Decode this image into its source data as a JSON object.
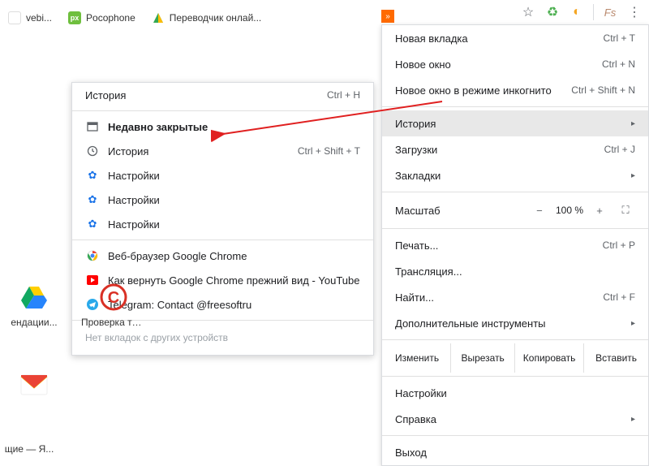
{
  "toolbar": {
    "star": "☆",
    "recycle": "♻",
    "ext2": "◐",
    "fs": "Fs",
    "more": "⋮"
  },
  "bookmarks": {
    "items": [
      {
        "label": "vebi..."
      },
      {
        "label": "Pocophone"
      },
      {
        "label": "Переводчик онлай..."
      }
    ]
  },
  "main_menu": {
    "group1": [
      {
        "label": "Новая вкладка",
        "shortcut": "Ctrl + T",
        "arrow": false,
        "highlight": false
      },
      {
        "label": "Новое окно",
        "shortcut": "Ctrl + N",
        "arrow": false,
        "highlight": false
      },
      {
        "label": "Новое окно в режиме инкогнито",
        "shortcut": "Ctrl + Shift + N",
        "arrow": false,
        "highlight": false
      }
    ],
    "group2": [
      {
        "label": "История",
        "shortcut": "",
        "arrow": true,
        "highlight": true
      },
      {
        "label": "Загрузки",
        "shortcut": "Ctrl + J",
        "arrow": false,
        "highlight": false
      },
      {
        "label": "Закладки",
        "shortcut": "",
        "arrow": true,
        "highlight": false
      }
    ],
    "zoom": {
      "label": "Масштаб",
      "minus": "−",
      "pct": "100 %",
      "plus": "+",
      "fs_icon": "⛶"
    },
    "group3": [
      {
        "label": "Печать...",
        "shortcut": "Ctrl + P",
        "arrow": false
      },
      {
        "label": "Трансляция...",
        "shortcut": "",
        "arrow": false
      },
      {
        "label": "Найти...",
        "shortcut": "Ctrl + F",
        "arrow": false
      },
      {
        "label": "Дополнительные инструменты",
        "shortcut": "",
        "arrow": true
      }
    ],
    "edit": {
      "label": "Изменить",
      "cut": "Вырезать",
      "copy": "Копировать",
      "paste": "Вставить"
    },
    "group4": [
      {
        "label": "Настройки",
        "shortcut": "",
        "arrow": false
      },
      {
        "label": "Справка",
        "shortcut": "",
        "arrow": true
      }
    ],
    "group5": [
      {
        "label": "Выход",
        "shortcut": "",
        "arrow": false
      }
    ]
  },
  "submenu": {
    "header": {
      "label": "История",
      "shortcut": "Ctrl + H"
    },
    "recent_label": "Недавно закрытые",
    "items": [
      {
        "label": "История",
        "shortcut": "Ctrl + Shift + T",
        "icon": "history"
      },
      {
        "label": "Настройки",
        "shortcut": "",
        "icon": "gear"
      },
      {
        "label": "Настройки",
        "shortcut": "",
        "icon": "gear"
      },
      {
        "label": "Настройки",
        "shortcut": "",
        "icon": "gear"
      }
    ],
    "items2": [
      {
        "label": "Веб-браузер Google Chrome",
        "icon": "chrome"
      },
      {
        "label": "Как вернуть Google Chrome прежний вид - YouTube",
        "icon": "youtube"
      },
      {
        "label": "Telegram: Contact @freesoftru",
        "icon": "telegram"
      }
    ],
    "footer": "Нет вкладок с других устройств"
  },
  "desktop": {
    "row1": [
      {
        "label": "ендации..."
      },
      {
        "label": "Проверка текс..."
      }
    ],
    "row2": [
      {
        "label": ""
      }
    ],
    "row3": [
      {
        "label": "щие — Я..."
      }
    ]
  }
}
